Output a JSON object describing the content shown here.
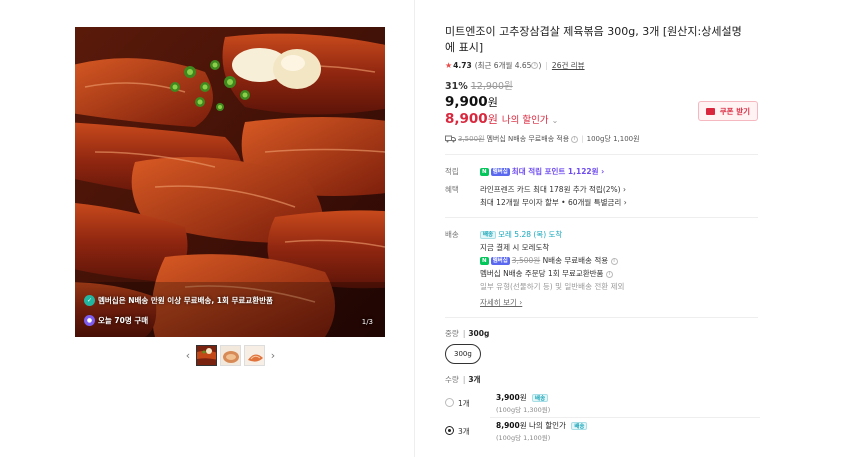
{
  "gallery": {
    "promo_1": "멤버십은 N배송 만원 이상 무료배송, 1회 무료교환반품",
    "promo_2": "오늘 70명 구매",
    "counter": "1/3",
    "prev_arrow": "‹",
    "next_arrow": "›"
  },
  "product": {
    "title": "미트엔조이 고추장삼겹살 제육볶음 300g, 3개 [원산지:상세설명에 표시]",
    "rating_score": "4.73",
    "rating_detail": "(최근 6개월 4.65",
    "rating_close": ")",
    "review_count": "26건 리뷰",
    "discount_rate": "31%",
    "original_price": "12,900원",
    "price": "9,900",
    "price_unit": "원",
    "my_price": "8,900",
    "my_price_unit": "원",
    "my_price_label": "나의 할인가",
    "coupon_label": "쿠폰 받기",
    "shipping_struck": "3,500원",
    "shipping_text": "멤버십 N배송 무료배송 적용",
    "unit_price": "100g당 1,100원"
  },
  "benefits": {
    "points_label": "적립",
    "points_text": "최대 적립 포인트 1,122원 ›",
    "benefit_label": "혜택",
    "benefit_line_1": "라인프렌즈 카드 최대 178원 추가 적립(2%) ›",
    "benefit_line_2": "최대 12개월 무이자 할부 • 60개월 특별금리 ›"
  },
  "delivery": {
    "label": "배송",
    "chip": "배송",
    "date": "모레 5.28 (목) 도착",
    "line_1": "지금 결제 시 모레도착",
    "struck": "3,500원",
    "line_2": "N배송 무료배송 적용",
    "line_3": "멤버십 N배송 주문당 1회 무료교환반품",
    "line_4": "일부 유형(선물하기 등) 및 일반배송 전환 제외",
    "more": "자세히 보기 ›"
  },
  "options": {
    "weight_label": "중량",
    "weight_value": "300g",
    "weight_button": "300g",
    "qty_label": "수량",
    "qty_value": "3개",
    "items": [
      {
        "name": "1개",
        "price": "3,900",
        "unit": "원",
        "label": "",
        "sub": "(100g당 1,300원)",
        "chip": "배송"
      },
      {
        "name": "3개",
        "price": "8,900",
        "unit": "원",
        "label": "나의 할인가",
        "sub": "(100g당 1,100원)",
        "chip": "배송"
      }
    ]
  },
  "chips": {
    "n": "N",
    "pay": "페이",
    "member": "멤버십"
  },
  "colors": {
    "sale_red": "#d9283e",
    "points_purple": "#6e4cf0",
    "delivery_teal": "#17a9be"
  }
}
